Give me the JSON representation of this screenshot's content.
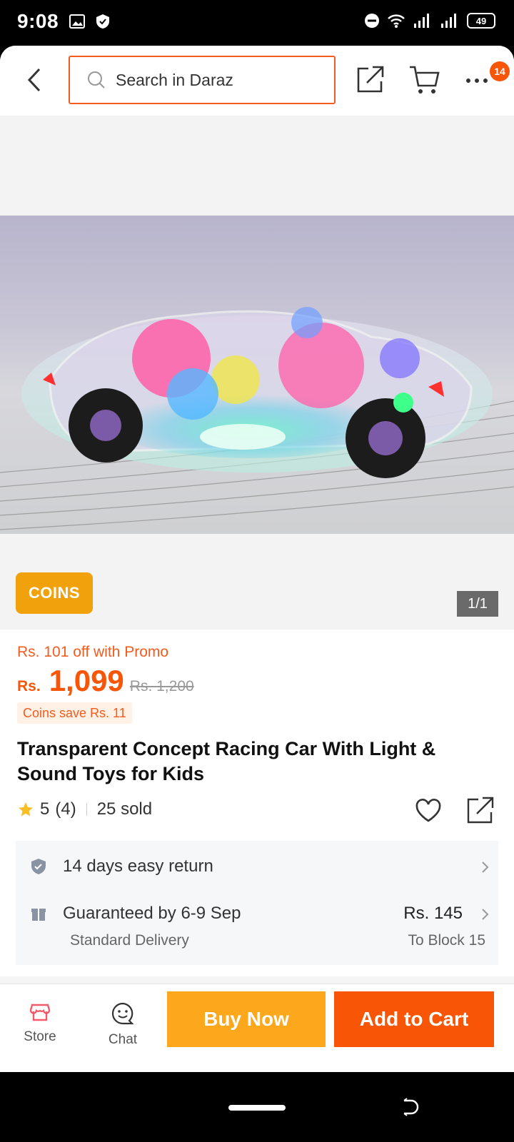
{
  "status_bar": {
    "time": "9:08",
    "battery": "49",
    "icons": [
      "image-icon",
      "shield-icon",
      "dnd-icon",
      "wifi-icon",
      "signal-icon",
      "signal-icon",
      "battery-icon"
    ]
  },
  "header": {
    "search_placeholder": "Search in Daraz",
    "cart_badge": "14",
    "icons": [
      "back-icon",
      "search-icon",
      "share-icon",
      "cart-icon",
      "more-icon"
    ]
  },
  "gallery": {
    "coins_label": "COINS",
    "page_counter": "1/1"
  },
  "product": {
    "promo_text": "Rs. 101 off with Promo",
    "currency": "Rs.",
    "price": "1,099",
    "original_price": "Rs. 1,200",
    "coins_save": "Coins save Rs. 11",
    "title": "Transparent Concept Racing Car With Light & Sound Toys for Kids",
    "rating": "5",
    "rating_count": "(4)",
    "sold": "25 sold"
  },
  "services": {
    "return_text": "14 days easy return",
    "delivery_text": "Guaranteed by 6-9 Sep",
    "delivery_type": "Standard Delivery",
    "shipping_price": "Rs. 145",
    "ship_to": "To Block 15"
  },
  "bottom_bar": {
    "store_label": "Store",
    "chat_label": "Chat",
    "buy_now_label": "Buy Now",
    "add_to_cart_label": "Add to Cart"
  },
  "colors": {
    "accent": "#f85606",
    "promo": "#f25c1f",
    "coins": "#f0a10c",
    "buy_now": "#fca71c"
  }
}
